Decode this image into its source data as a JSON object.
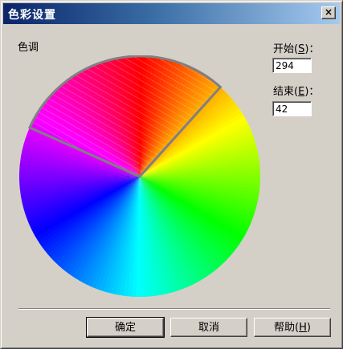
{
  "window": {
    "title": "色彩设置",
    "close_glyph": "×"
  },
  "hue": {
    "label": "色调",
    "selection_start_deg": 294,
    "selection_end_deg": 42,
    "highlight_color": "#808080"
  },
  "start": {
    "label": "开始",
    "accel": "S",
    "suffix": "：",
    "value": "294"
  },
  "end": {
    "label": "结束",
    "accel": "E",
    "suffix": "：",
    "value": "42"
  },
  "buttons": {
    "ok": "确定",
    "cancel": "取消",
    "help_label": "帮助",
    "help_accel": "H"
  },
  "colors": {
    "dialog_bg": "#d4d0c8",
    "title_from": "#0a246a",
    "title_to": "#a6caf0"
  }
}
